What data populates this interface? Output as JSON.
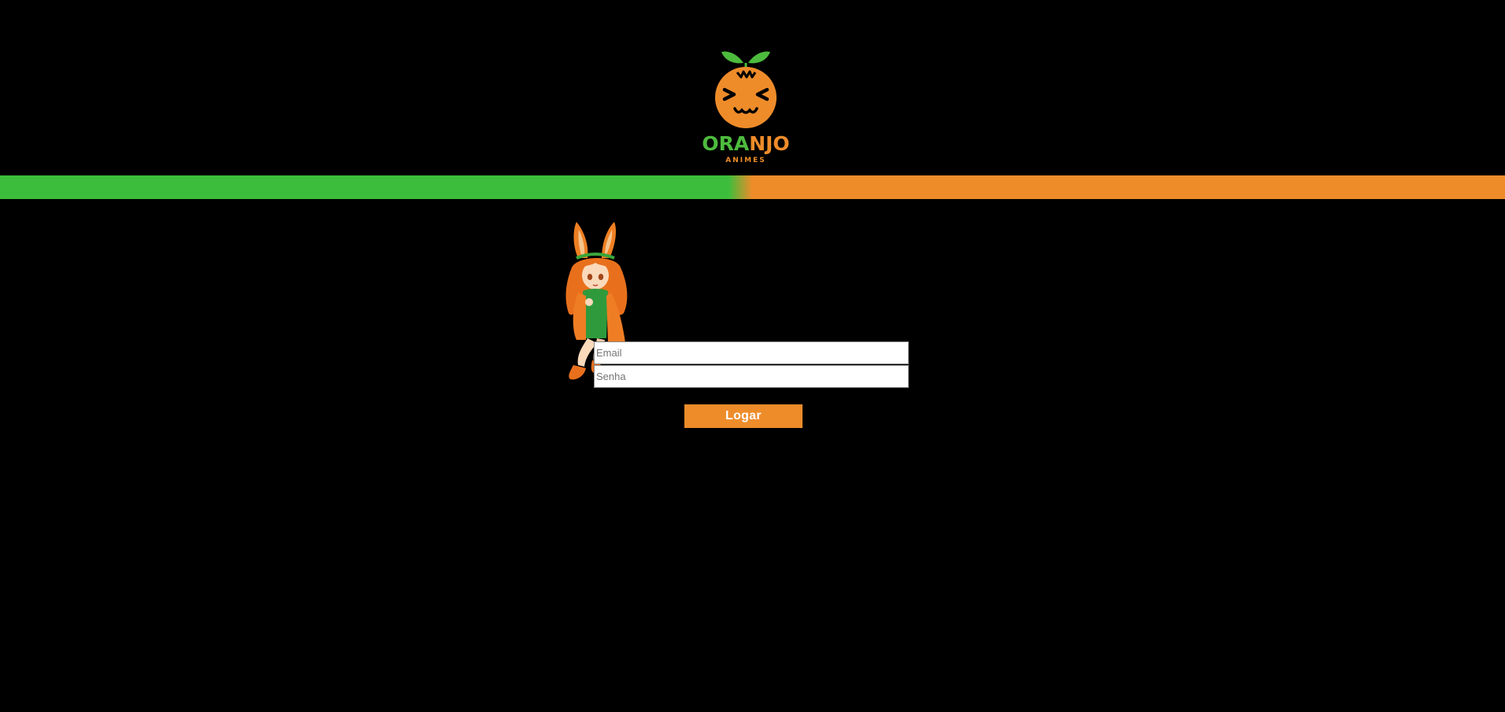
{
  "header": {
    "logo": {
      "icon": "orange-mascot-logo",
      "name_part1": "ORA",
      "name_part2": "NJO",
      "subtitle": "ANIMES"
    }
  },
  "band": {
    "left_color": "#3cbe3c",
    "right_color": "#ee8c2a"
  },
  "login": {
    "mascot_icon": "bunny-girl-mascot",
    "email_placeholder": "Email",
    "password_placeholder": "Senha",
    "submit_label": "Logar",
    "accent_color": "#ee8c2a"
  }
}
